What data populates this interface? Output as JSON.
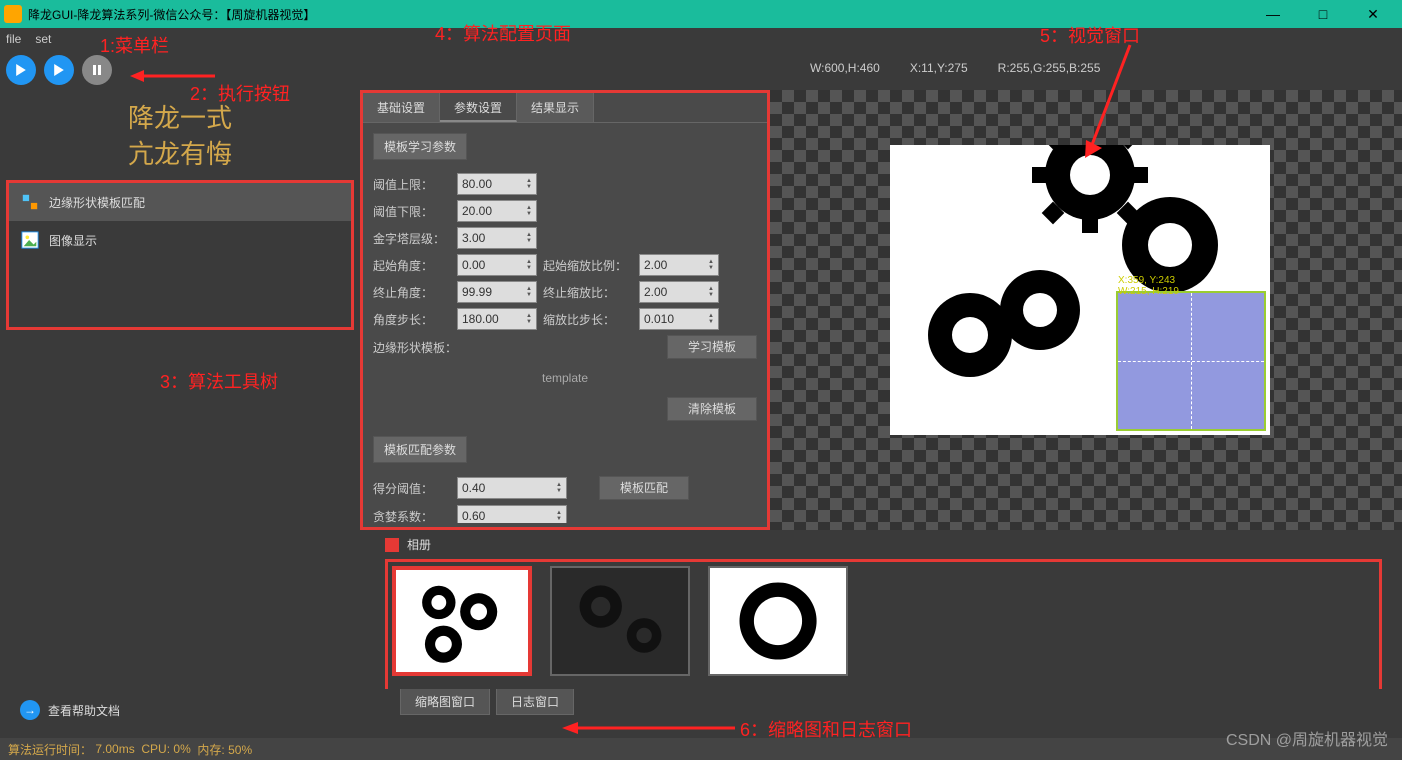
{
  "window": {
    "title": "降龙GUI-降龙算法系列-微信公众号：【周旋机器视觉】"
  },
  "menu": {
    "file": "file",
    "set": "set"
  },
  "brand": {
    "line1": "降龙一式",
    "line2": "亢龙有悔"
  },
  "tree": {
    "item1": "边缘形状模板匹配",
    "item2": "图像显示"
  },
  "config": {
    "tabs": {
      "basic": "基础设置",
      "param": "参数设置",
      "result": "结果显示"
    },
    "group1": "模板学习参数",
    "thresh_hi_lbl": "阈值上限：",
    "thresh_hi": "80.00",
    "thresh_lo_lbl": "阈值下限：",
    "thresh_lo": "20.00",
    "pyramid_lbl": "金字塔层级：",
    "pyramid": "3.00",
    "start_ang_lbl": "起始角度：",
    "start_ang": "0.00",
    "start_scale_lbl": "起始缩放比例：",
    "start_scale": "2.00",
    "end_ang_lbl": "终止角度：",
    "end_ang": "99.99",
    "end_scale_lbl": "终止缩放比：",
    "end_scale": "2.00",
    "ang_step_lbl": "角度步长：",
    "ang_step": "180.00",
    "scale_step_lbl": "缩放比步长：",
    "scale_step": "0.010",
    "shape_lbl": "边缘形状模板：",
    "learn_btn": "学习模板",
    "template_name": "template",
    "clear_btn": "清除模板",
    "group2": "模板匹配参数",
    "score_lbl": "得分阈值：",
    "score": "0.40",
    "greedy_lbl": "贪婪系数：",
    "greedy": "0.60",
    "match_btn": "模板匹配"
  },
  "info": {
    "wh": "W:600,H:460",
    "xy": "X:11,Y:275",
    "rgb": "R:255,G:255,B:255"
  },
  "roi": {
    "coords": "X:359, Y:243",
    "coords2": "W:215, H:219"
  },
  "album": {
    "title": "相册"
  },
  "bottom_tabs": {
    "thumb": "缩略图窗口",
    "log": "日志窗口"
  },
  "help": "查看帮助文档",
  "status": {
    "runtime_lbl": "算法运行时间：",
    "runtime": "7.00ms",
    "cpu": "CPU: 0%",
    "mem": "内存: 50%"
  },
  "watermark": "CSDN @周旋机器视觉",
  "anno": {
    "a1": "1:菜单栏",
    "a2": "2：执行按钮",
    "a3": "3：算法工具树",
    "a4": "4：算法配置页面",
    "a5": "5：视觉窗口",
    "a6": "6：缩略图和日志窗口"
  }
}
